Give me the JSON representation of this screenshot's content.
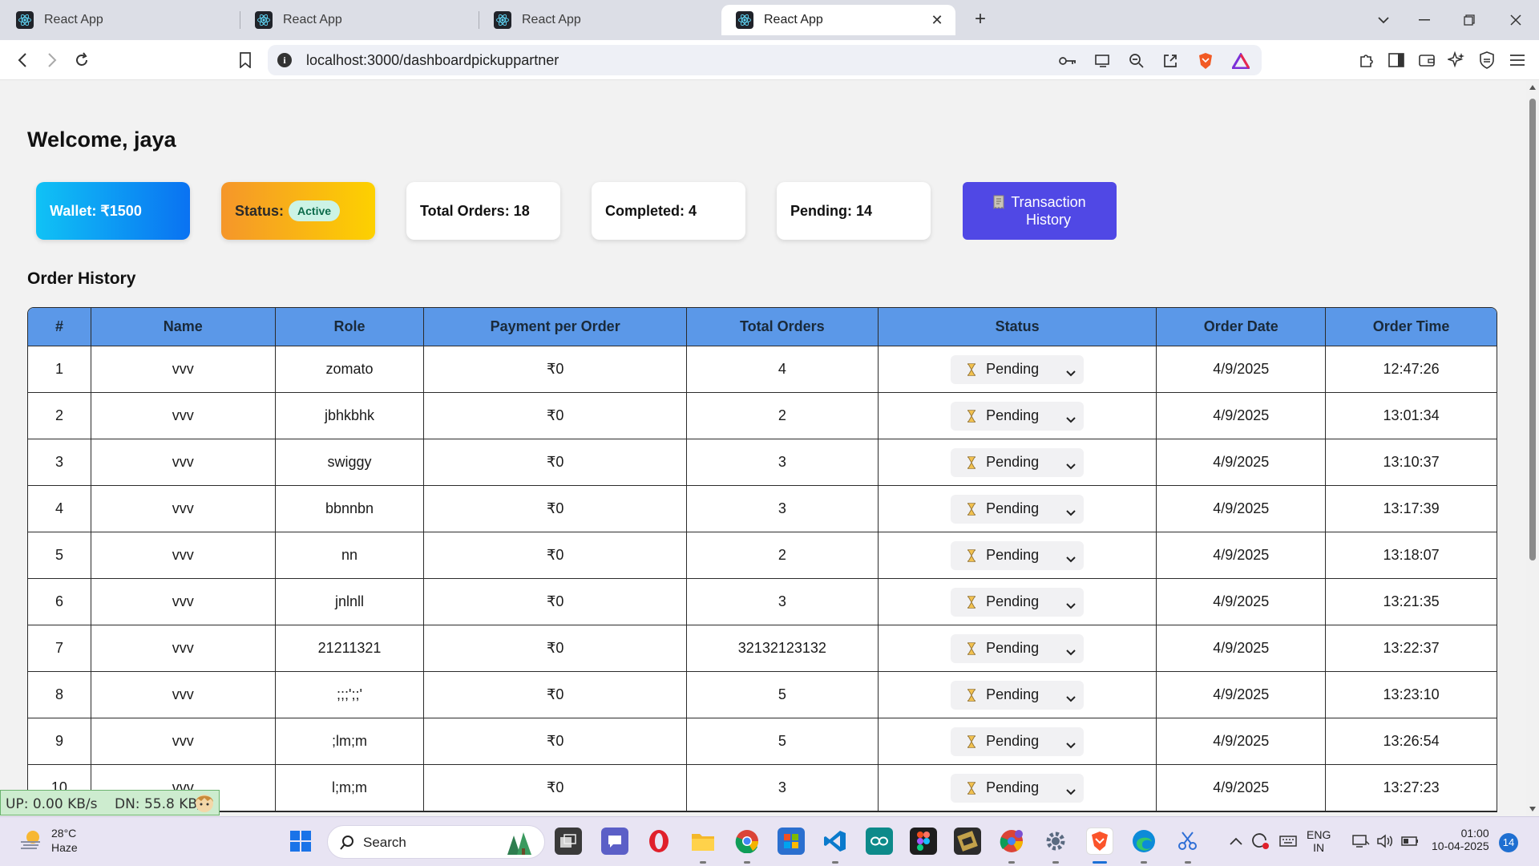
{
  "browser": {
    "tabs": [
      {
        "title": "React App",
        "active": false
      },
      {
        "title": "React App",
        "active": false
      },
      {
        "title": "React App",
        "active": false
      },
      {
        "title": "React App",
        "active": true
      }
    ],
    "url": "localhost:3000/dashboardpickuppartner"
  },
  "page": {
    "welcome": "Welcome, jaya",
    "cards": {
      "wallet": "Wallet: ₹1500",
      "status_label": "Status:",
      "status_badge": "Active",
      "total_orders": "Total Orders: 18",
      "completed": "Completed: 4",
      "pending": "Pending: 14"
    },
    "transaction_button": {
      "icon": "receipt-icon",
      "line1": "Transaction",
      "line2": "History"
    },
    "order_history_title": "Order History",
    "table": {
      "headers": [
        "#",
        "Name",
        "Role",
        "Payment per Order",
        "Total Orders",
        "Status",
        "Order Date",
        "Order Time"
      ],
      "rows": [
        {
          "num": "1",
          "name": "vvv",
          "role": "zomato",
          "payment": "₹0",
          "total": "4",
          "status": "Pending",
          "date": "4/9/2025",
          "time": "12:47:26"
        },
        {
          "num": "2",
          "name": "vvv",
          "role": "jbhkbhk",
          "payment": "₹0",
          "total": "2",
          "status": "Pending",
          "date": "4/9/2025",
          "time": "13:01:34"
        },
        {
          "num": "3",
          "name": "vvv",
          "role": "swiggy",
          "payment": "₹0",
          "total": "3",
          "status": "Pending",
          "date": "4/9/2025",
          "time": "13:10:37"
        },
        {
          "num": "4",
          "name": "vvv",
          "role": "bbnnbn",
          "payment": "₹0",
          "total": "3",
          "status": "Pending",
          "date": "4/9/2025",
          "time": "13:17:39"
        },
        {
          "num": "5",
          "name": "vvv",
          "role": "nn",
          "payment": "₹0",
          "total": "2",
          "status": "Pending",
          "date": "4/9/2025",
          "time": "13:18:07"
        },
        {
          "num": "6",
          "name": "vvv",
          "role": "jnlnll",
          "payment": "₹0",
          "total": "3",
          "status": "Pending",
          "date": "4/9/2025",
          "time": "13:21:35"
        },
        {
          "num": "7",
          "name": "vvv",
          "role": "21211321",
          "payment": "₹0",
          "total": "32132123132",
          "status": "Pending",
          "date": "4/9/2025",
          "time": "13:22:37"
        },
        {
          "num": "8",
          "name": "vvv",
          "role": ";;;';;'",
          "payment": "₹0",
          "total": "5",
          "status": "Pending",
          "date": "4/9/2025",
          "time": "13:23:10"
        },
        {
          "num": "9",
          "name": "vvv",
          "role": ";lm;m",
          "payment": "₹0",
          "total": "5",
          "status": "Pending",
          "date": "4/9/2025",
          "time": "13:26:54"
        },
        {
          "num": "10",
          "name": "vvv",
          "role": "l;m;m",
          "payment": "₹0",
          "total": "3",
          "status": "Pending",
          "date": "4/9/2025",
          "time": "13:27:23"
        }
      ]
    }
  },
  "network_monitor": {
    "up": "UP: 0.00 KB/s",
    "down": "DN: 55.8 KB/s"
  },
  "taskbar": {
    "weather_temp": "28°C",
    "weather_cond": "Haze",
    "search_label": "Search",
    "lang_top": "ENG",
    "lang_bottom": "IN",
    "time": "01:00",
    "date": "10-04-2025",
    "notification_count": "14"
  },
  "colors": {
    "table_header": "#5b98e8",
    "transaction_button": "#5048e5",
    "wallet_gradient": [
      "#10c2f5",
      "#0a72f2"
    ],
    "status_gradient": [
      "#f5962a",
      "#fdd100"
    ]
  }
}
